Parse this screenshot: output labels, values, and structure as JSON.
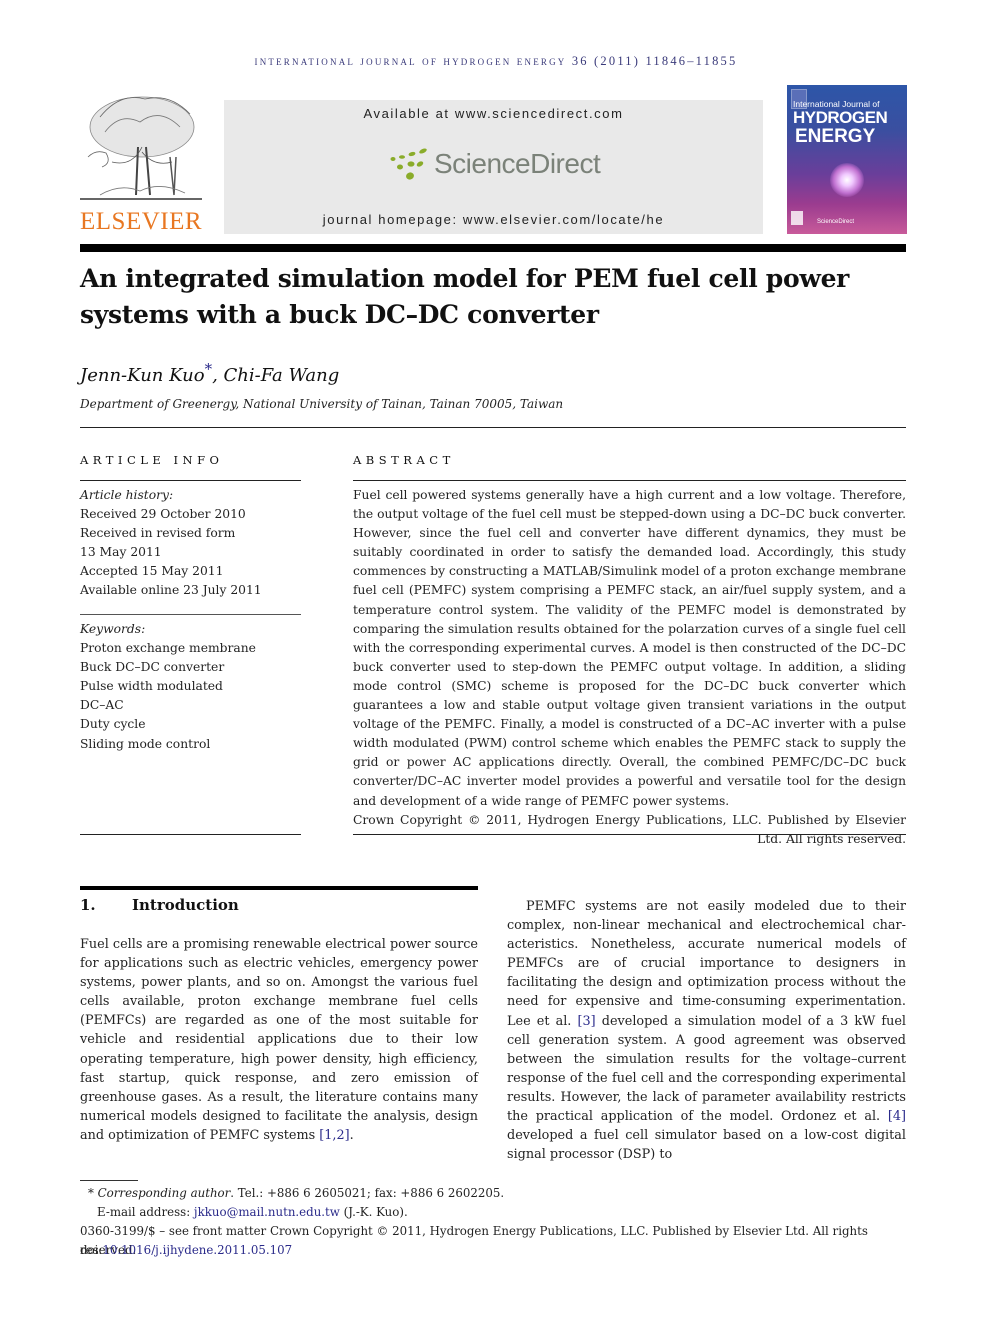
{
  "running_head": "International Journal of Hydrogen Energy 36 (2011) 11846–11855",
  "header": {
    "publisher_logo_text": "ELSEVIER",
    "sciencedirect_available": "Available at www.sciencedirect.com",
    "sciencedirect_logo_text": "ScienceDirect",
    "journal_homepage": "journal homepage: www.elsevier.com/locate/he",
    "cover": {
      "line1": "International Journal of",
      "line2": "HYDROGEN",
      "line3": "ENERGY",
      "footer": "ScienceDirect"
    },
    "colors": {
      "elsevier_orange": "#e87722",
      "sciencedirect_green": "#8aac2a",
      "link_blue": "#2a2a8a",
      "banner_gray": "#e9e9e9"
    }
  },
  "article": {
    "title_line1": "An integrated simulation model for PEM fuel cell power",
    "title_line2": "systems with a buck DC–DC converter",
    "author1": "Jenn-Kun Kuo",
    "author1_mark": "*",
    "author_sep": ", ",
    "author2": "Chi-Fa Wang",
    "affiliation": "Department of Greenergy, National University of Tainan, Tainan 70005, Taiwan"
  },
  "article_info": {
    "heading": "ARTICLE INFO",
    "history_label": "Article history:",
    "history": [
      "Received 29 October 2010",
      "Received in revised form",
      "13 May 2011",
      "Accepted 15 May 2011",
      "Available online 23 July 2011"
    ],
    "keywords_label": "Keywords:",
    "keywords": [
      "Proton exchange membrane",
      "Buck DC–DC converter",
      "Pulse width modulated",
      "DC–AC",
      "Duty cycle",
      "Sliding mode control"
    ]
  },
  "abstract": {
    "heading": "ABSTRACT",
    "text": "Fuel cell powered systems generally have a high current and a low voltage. Therefore, the output voltage of the fuel cell must be stepped-down using a DC–DC buck converter. However, since the fuel cell and converter have different dynamics, they must be suitably coordinated in order to satisfy the demanded load. Accordingly, this study commences by constructing a MATLAB/Simulink model of a proton exchange membrane fuel cell (PEMFC) system comprising a PEMFC stack, an air/fuel supply system, and a temperature control system. The validity of the PEMFC model is demonstrated by comparing the simulation results obtained for the polarzation curves of a single fuel cell with the corresponding experimental curves. A model is then constructed of the DC–DC buck converter used to step-down the PEMFC output voltage. In addition, a sliding mode control (SMC) scheme is proposed for the DC–DC buck converter which guarantees a low and stable output voltage given transient variations in the output voltage of the PEMFC. Finally, a model is con­structed of a DC–AC inverter with a pulse width modulated (PWM) control scheme which enables the PEMFC stack to supply the grid or power AC applications directly. Overall, the combined PEMFC/DC–DC buck converter/DC–AC inverter model provides a powerful and versatile tool for the design and development of a wide range of PEMFC power systems.",
    "copyright": "Crown Copyright © 2011, Hydrogen Energy Publications, LLC. Published by Elsevier Ltd. All rights reserved."
  },
  "introduction": {
    "number": "1.",
    "heading": "Introduction",
    "para1": "Fuel cells are a promising renewable electrical power source for applications such as electric vehicles, emergency power systems, power plants, and so on. Amongst the various fuel cells available, proton exchange membrane fuel cells (PEMFCs) are regarded as one of the most suitable for vehicle and residential applications due to their low operating temperature, high power density, high efficiency, fast startup, quick response, and zero emission of greenhouse gases. As a result, the literature contains many numerical models designed to facilitate the analysis, design and optimization of PEMFC systems ",
    "para1_cite": "[1,2]",
    "para1_end": ".",
    "para2_a": "PEMFC systems are not easily modeled due to their complex, non-linear mechanical and electrochemical char­acteristics. Nonetheless, accurate numerical models of PEMFCs are of crucial importance to designers in facilitating the design and optimization process without the need for expensive and time-consuming experimentation. Lee et al. ",
    "para2_cite1": "[3]",
    "para2_b": " developed a simulation model of a 3 kW fuel cell generation system. A good agreement was observed between the simu­lation results for the voltage–current response of the fuel cell and the corresponding experimental results. However, the lack of parameter availability restricts the practical applica­tion of the model. Ordonez et al. ",
    "para2_cite2": "[4]",
    "para2_c": " developed a fuel cell simulator based on a low-cost digital signal processor (DSP) to"
  },
  "footnotes": {
    "mark": "*",
    "corresponding_label": "Corresponding author",
    "contact": ". Tel.: +886 6 2605021; fax: +886 6 2602205.",
    "email_label": "E-mail address: ",
    "email": "jkkuo@mail.nutn.edu.tw",
    "email_suffix": " (J.-K. Kuo).",
    "front_matter": "0360-3199/$ – see front matter Crown Copyright © 2011, Hydrogen Energy Publications, LLC. Published by Elsevier Ltd. All rights reserved.",
    "doi_label": "doi:",
    "doi": "10.1016/j.ijhydene.2011.05.107"
  }
}
